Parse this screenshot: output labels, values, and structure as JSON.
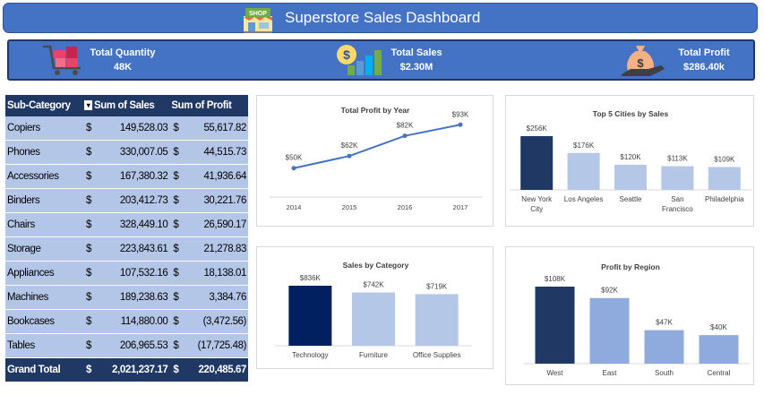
{
  "header": {
    "title": "Superstore Sales Dashboard",
    "icon": "shop-icon",
    "icon_label": "SHOP"
  },
  "kpis": [
    {
      "label": "Total Quantity",
      "value": "48K",
      "icon": "shopping-cart-icon"
    },
    {
      "label": "Total Sales",
      "value": "$2.30M",
      "icon": "sales-growth-icon"
    },
    {
      "label": "Total Profit",
      "value": "$286.40k",
      "icon": "money-bag-icon"
    }
  ],
  "pivot_table": {
    "headers": [
      "Sub-Category",
      "Sum of Sales",
      "Sum of Profit"
    ],
    "currency_symbol": "$",
    "rows": [
      {
        "name": "Copiers",
        "sales": "149,528.03",
        "profit": "55,617.82"
      },
      {
        "name": "Phones",
        "sales": "330,007.05",
        "profit": "44,515.73"
      },
      {
        "name": "Accessories",
        "sales": "167,380.32",
        "profit": "41,936.64"
      },
      {
        "name": "Binders",
        "sales": "203,412.73",
        "profit": "30,221.76"
      },
      {
        "name": "Chairs",
        "sales": "328,449.10",
        "profit": "26,590.17"
      },
      {
        "name": "Storage",
        "sales": "223,843.61",
        "profit": "21,278.83"
      },
      {
        "name": "Appliances",
        "sales": "107,532.16",
        "profit": "18,138.01"
      },
      {
        "name": "Machines",
        "sales": "189,238.63",
        "profit": "3,384.76"
      },
      {
        "name": "Bookcases",
        "sales": "114,880.00",
        "profit": "(3,472.56)"
      },
      {
        "name": "Tables",
        "sales": "206,965.53",
        "profit": "(17,725.48)"
      }
    ],
    "total": {
      "name": "Grand Total",
      "sales": "2,021,237.17",
      "profit": "220,485.67"
    }
  },
  "chart_data": [
    {
      "type": "line",
      "title": "Total Profit by Year",
      "x": [
        "2014",
        "2015",
        "2016",
        "2017"
      ],
      "values": [
        50,
        62,
        82,
        93
      ],
      "labels": [
        "$50K",
        "$62K",
        "$82K",
        "$93K"
      ],
      "color": "#4472c4"
    },
    {
      "type": "bar",
      "title": "Top 5 Cities by Sales",
      "categories": [
        "New York City",
        "Los Angeles",
        "Seattle",
        "San Francisco",
        "Philadelphia"
      ],
      "values": [
        256,
        176,
        120,
        113,
        109
      ],
      "labels": [
        "$256K",
        "$176K",
        "$120K",
        "$113K",
        "$109K"
      ],
      "colors": [
        "#203864",
        "#b4c7e7",
        "#b4c7e7",
        "#b4c7e7",
        "#b4c7e7"
      ]
    },
    {
      "type": "bar",
      "title": "Sales by Category",
      "categories": [
        "Technology",
        "Furniture",
        "Office Supplies"
      ],
      "values": [
        836,
        742,
        719
      ],
      "labels": [
        "$836K",
        "$742K",
        "$719K"
      ],
      "colors": [
        "#002060",
        "#b4c7e7",
        "#b4c7e7"
      ]
    },
    {
      "type": "bar",
      "title": "Profit by Region",
      "categories": [
        "West",
        "East",
        "South",
        "Central"
      ],
      "values": [
        108,
        92,
        47,
        40
      ],
      "labels": [
        "$108K",
        "$92K",
        "$47K",
        "$40K"
      ],
      "colors": [
        "#203864",
        "#8faadc",
        "#8faadc",
        "#8faadc"
      ]
    }
  ]
}
